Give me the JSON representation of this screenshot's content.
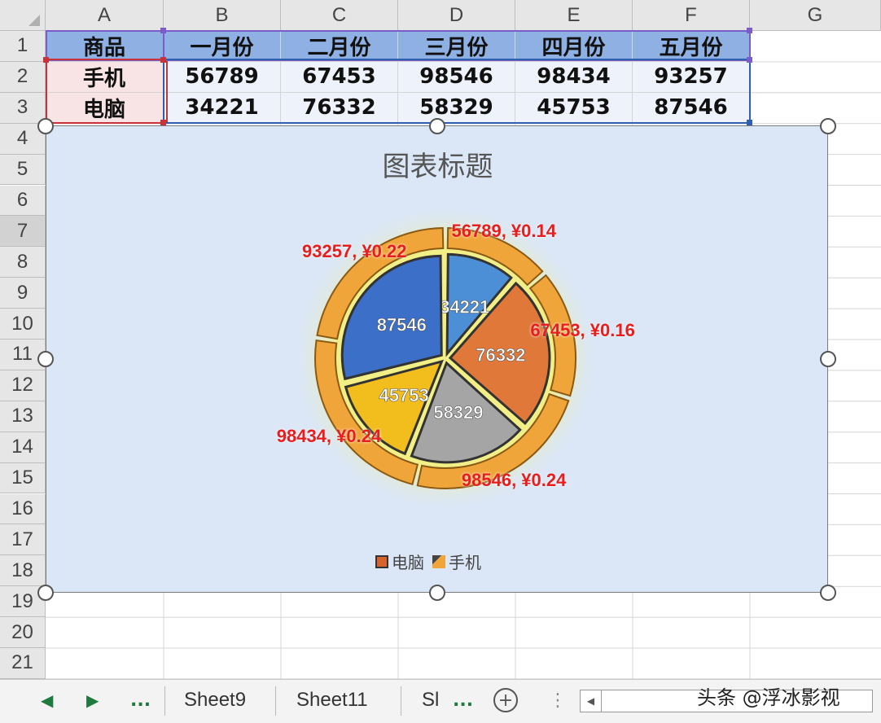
{
  "columns": [
    "A",
    "B",
    "C",
    "D",
    "E",
    "F",
    "G"
  ],
  "rows": [
    "1",
    "2",
    "3",
    "4",
    "5",
    "6",
    "7",
    "8",
    "9",
    "10",
    "11",
    "12",
    "13",
    "14",
    "15",
    "16",
    "17",
    "18",
    "19",
    "20",
    "21"
  ],
  "table": {
    "header": [
      "商品",
      "一月份",
      "二月份",
      "三月份",
      "四月份",
      "五月份"
    ],
    "body": [
      [
        "手机",
        "56789",
        "67453",
        "98546",
        "98434",
        "93257"
      ],
      [
        "电脑",
        "34221",
        "76332",
        "58329",
        "45753",
        "87546"
      ]
    ]
  },
  "chart_data": {
    "type": "pie",
    "title": "图表标题",
    "legend_position": "bottom",
    "series": [
      {
        "name": "电脑",
        "ring": "inner",
        "values": [
          34221,
          76332,
          58329,
          45753,
          87546
        ],
        "labels": [
          "34221",
          "76332",
          "58329",
          "45753",
          "87546"
        ]
      },
      {
        "name": "手机",
        "ring": "outer",
        "values": [
          56789,
          67453,
          98546,
          98434,
          93257
        ],
        "labels": [
          "56789, ¥0.14",
          "67453, ¥0.16",
          "98546, ¥0.24",
          "98434, ¥0.24",
          "93257, ¥0.22"
        ]
      }
    ],
    "inner_colors": [
      "#4d8fd6",
      "#e0783a",
      "#a5a5a5",
      "#f2be1d",
      "#3c6fc7"
    ],
    "outer_color": "#f0a53a",
    "label_color_outer": "#e81d1d",
    "label_color_inner": "#ffffff"
  },
  "legend": [
    {
      "label": "电脑",
      "color": "#d8622b"
    },
    {
      "label": "手机",
      "color": "#f0a53a"
    }
  ],
  "tabs": {
    "nav_prev": "◀",
    "nav_next": "▶",
    "ellipsis": "...",
    "sheets": [
      "Sheet9",
      "Sheet11",
      "Sl"
    ],
    "more": "...",
    "add": "+",
    "vdots": "⋮"
  },
  "watermark": "头条 @浮冰影视"
}
